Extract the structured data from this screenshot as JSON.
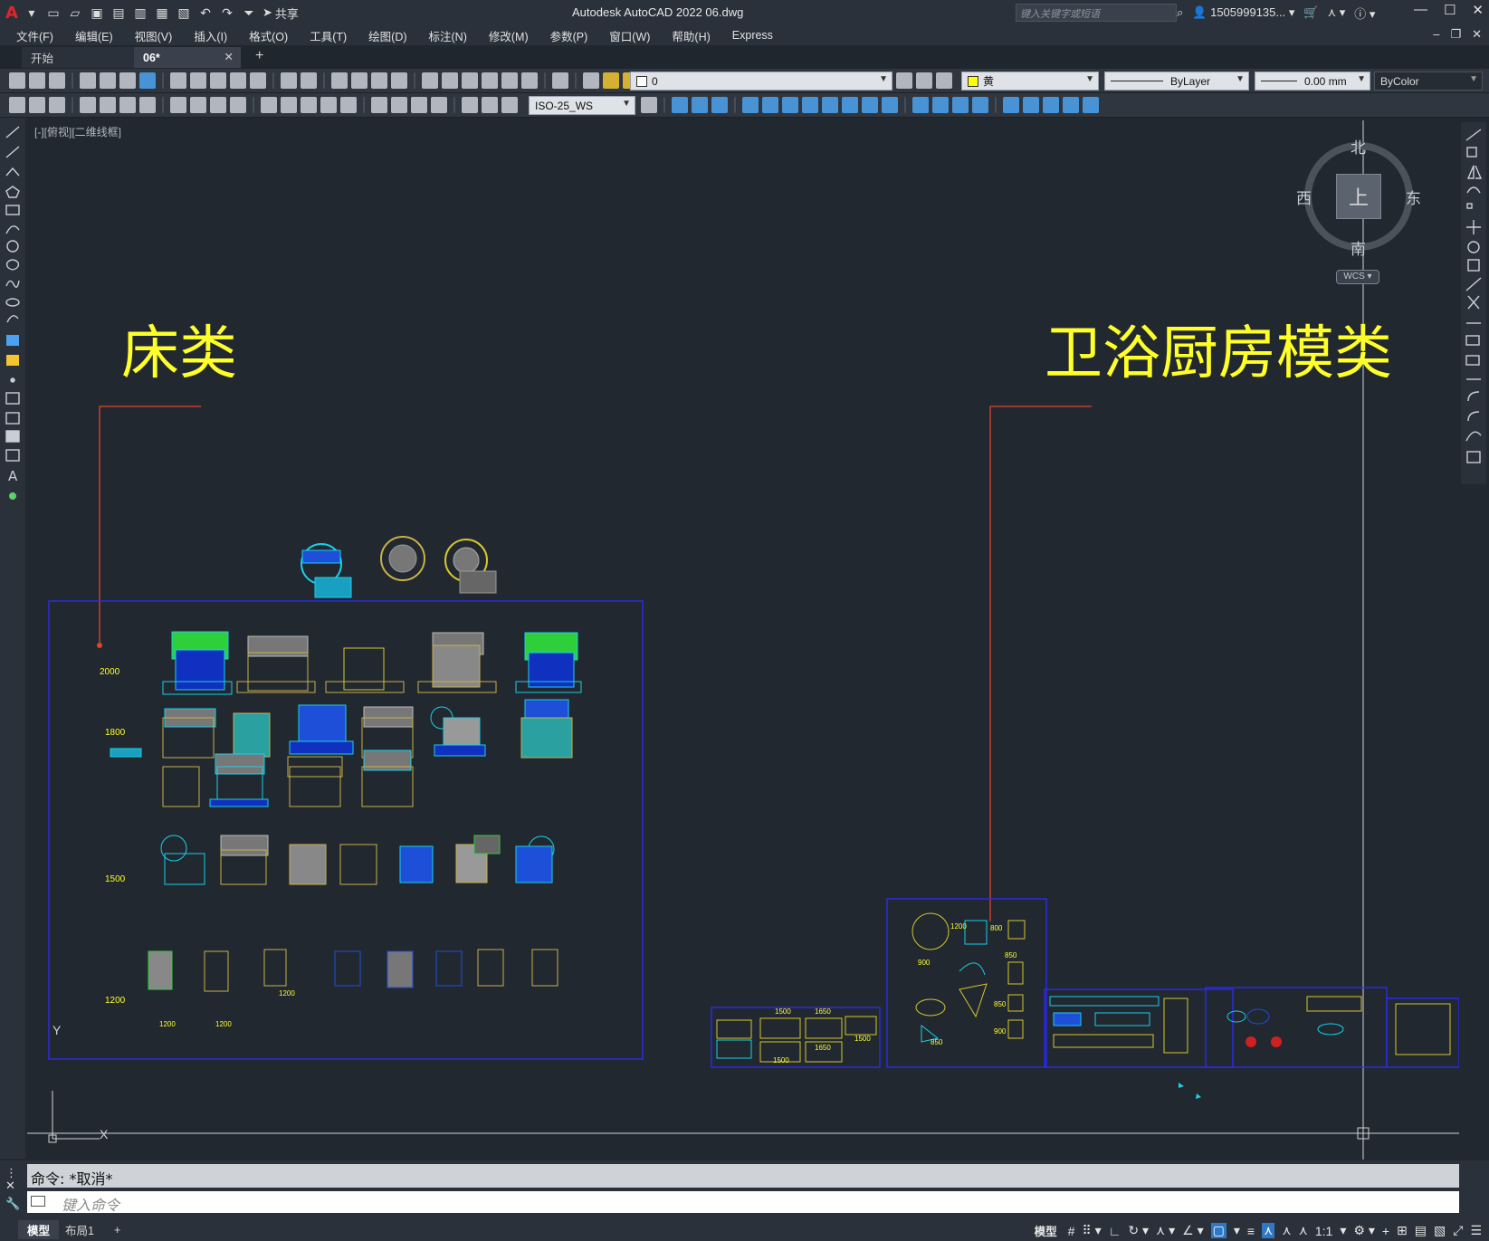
{
  "app": {
    "title": "Autodesk AutoCAD 2022    06.dwg",
    "share_label": "共享",
    "search_placeholder": "键入关键字或短语",
    "user": "1505999135...",
    "logo": "A"
  },
  "menu": [
    "文件(F)",
    "编辑(E)",
    "视图(V)",
    "插入(I)",
    "格式(O)",
    "工具(T)",
    "绘图(D)",
    "标注(N)",
    "修改(M)",
    "参数(P)",
    "窗口(W)",
    "帮助(H)",
    "Express"
  ],
  "tabs": {
    "start": "开始",
    "active": "06*"
  },
  "toolbar": {
    "layer": "0",
    "color": "黄",
    "color_hex": "#ffff00",
    "linetype": "ByLayer",
    "lineweight": "0.00 mm",
    "plotstyle": "ByColor",
    "dimstyle": "ISO-25_WS"
  },
  "canvas": {
    "viewport_label": "[-][俯视][二维线框]",
    "label_left": "床类",
    "label_right": "卫浴厨房模类",
    "label_color": "#ffff2a",
    "bed_widths": [
      "2000",
      "1800",
      "1500",
      "1200"
    ],
    "bath_dims": [
      "1500",
      "1650",
      "1500",
      "1650",
      "1500",
      "1200",
      "800",
      "850",
      "900",
      "850",
      "900",
      "850"
    ],
    "bed_small_dims": [
      "1200",
      "1200",
      "1200"
    ],
    "ucs": {
      "y": "Y",
      "x": "X"
    }
  },
  "viewcube": {
    "north": "北",
    "south": "南",
    "east": "东",
    "west": "西",
    "top": "上",
    "wcs": "WCS"
  },
  "command": {
    "history": "命令: *取消*",
    "placeholder": "键入命令"
  },
  "status": {
    "model_tab": "模型",
    "layout_tab": "布局1",
    "add": "+",
    "model_btn": "模型",
    "scale": "1:1"
  }
}
